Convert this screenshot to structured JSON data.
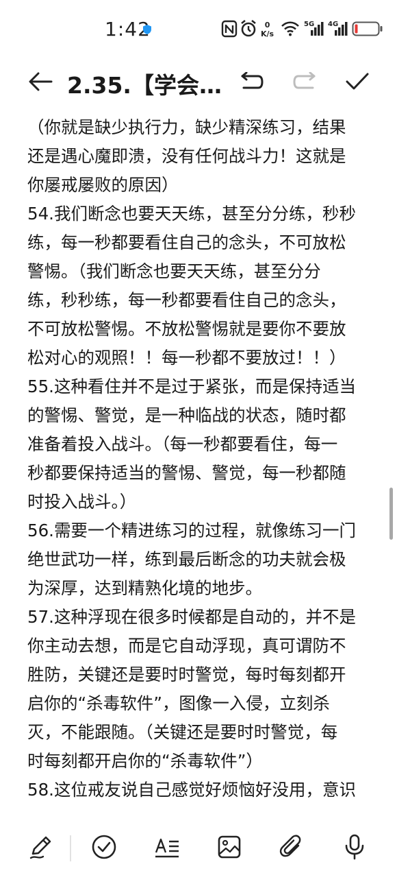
{
  "status_bar": {
    "time": "1:42",
    "net_speed_value": "0",
    "net_speed_unit": "K/s",
    "signal_1_label": "5G",
    "signal_2_label": "4G",
    "battery_color": "#e53935",
    "shield_color": "#2196f3"
  },
  "toolbar": {
    "title": "2.35.【学会…"
  },
  "content": {
    "paragraphs": [
      "（你就是缺少执行力，缺少精深练习，结果\n还是遇心魔即溃，没有任何战斗力！这就是\n你屡戒屡败的原因）",
      "54.我们断念也要天天练，甚至分分练，秒秒\n练，每一秒都要看住自己的念头，不可放松\n警惕。（我们断念也要天天练，甚至分分\n练，秒秒练，每一秒都要看住自己的念头，\n不可放松警惕。不放松警惕就是要你不要放\n松对心的观照！！每一秒都不要放过！！）",
      "55.这种看住并不是过于紧张，而是保持适当\n的警惕、警觉，是一种临战的状态，随时都\n准备着投入战斗。（每一秒都要看住，每一\n秒都要保持适当的警惕、警觉，每一秒都随\n时投入战斗。）",
      "56.需要一个精进练习的过程，就像练习一门\n绝世武功一样，练到最后断念的功夫就会极\n为深厚，达到精熟化境的地步。",
      "57.这种浮现在很多时候都是自动的，并不是\n你主动去想，而是它自动浮现，真可谓防不\n胜防，关键还是要时时警觉，每时每刻都开\n启你的“杀毒软件”，图像一入侵，立刻杀\n灭，不能跟随。（关键还是要时时警觉，每\n时每刻都开启你的“杀毒软件”）",
      "58.这位戒友说自己感觉好烦恼好没用，意识"
    ]
  },
  "icons": {
    "back": "arrow-left-icon",
    "undo": "undo-icon",
    "redo": "redo-icon",
    "done": "checkmark-icon",
    "pen": "pen-icon",
    "checklist": "check-circle-icon",
    "text_format": "text-format-icon",
    "image": "image-icon",
    "attach": "paperclip-icon",
    "mic": "microphone-icon"
  }
}
